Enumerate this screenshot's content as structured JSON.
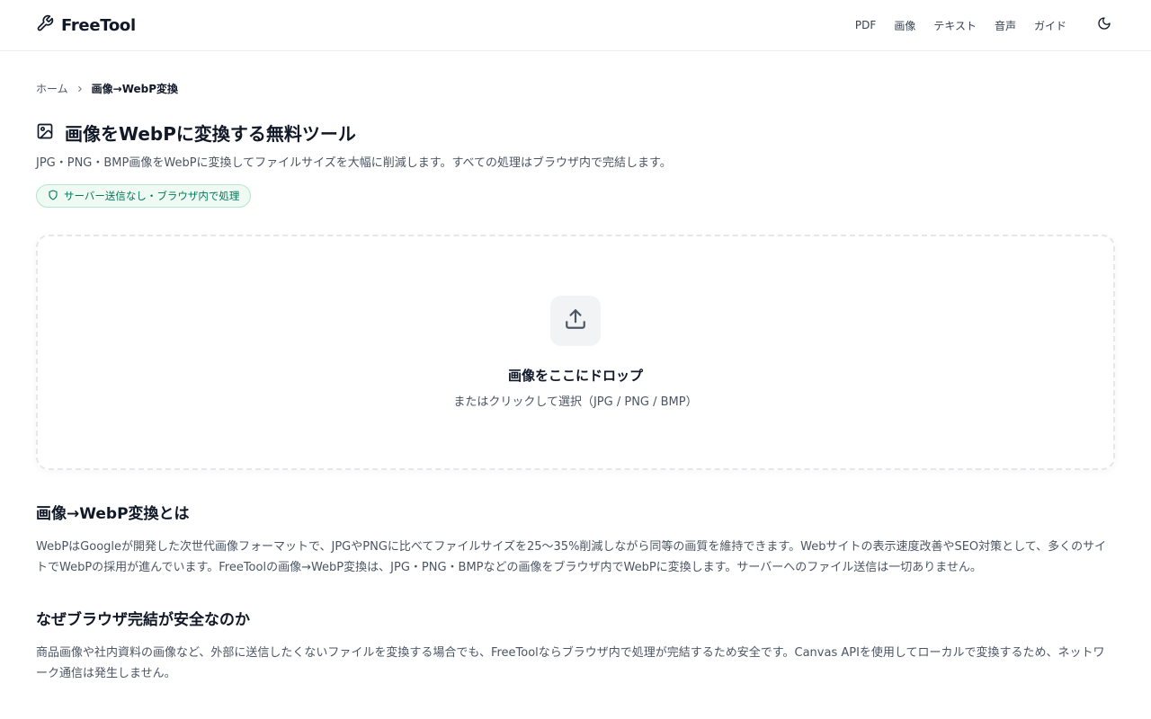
{
  "header": {
    "logo_text": "FreeTool",
    "nav": [
      "PDF",
      "画像",
      "テキスト",
      "音声",
      "ガイド"
    ],
    "theme_icon": "moon-icon"
  },
  "breadcrumb": {
    "home": "ホーム",
    "current": "画像→WebP変換"
  },
  "page": {
    "title": "画像をWebPに変換する無料ツール",
    "subtitle": "JPG・PNG・BMP画像をWebPに変換してファイルサイズを大幅に削減します。すべての処理はブラウザ内で完結します。",
    "badge": "サーバー送信なし・ブラウザ内で処理"
  },
  "dropzone": {
    "title": "画像をここにドロップ",
    "subtitle": "またはクリックして選択（JPG / PNG / BMP）"
  },
  "sections": [
    {
      "heading": "画像→WebP変換とは",
      "body": "WebPはGoogleが開発した次世代画像フォーマットで、JPGやPNGに比べてファイルサイズを25〜35%削減しながら同等の画質を維持できます。Webサイトの表示速度改善やSEO対策として、多くのサイトでWebPの採用が進んでいます。FreeToolの画像→WebP変換は、JPG・PNG・BMPなどの画像をブラウザ内でWebPに変換します。サーバーへのファイル送信は一切ありません。"
    },
    {
      "heading": "なぜブラウザ完結が安全なのか",
      "body": "商品画像や社内資料の画像など、外部に送信したくないファイルを変換する場合でも、FreeToolならブラウザ内で処理が完結するため安全です。Canvas APIを使用してローカルで変換するため、ネットワーク通信は発生しません。"
    }
  ],
  "colors": {
    "badge_text": "#047857",
    "badge_bg": "#eefaf3",
    "badge_border": "#b7e4cc",
    "text_primary": "#111827",
    "text_secondary": "#4b5563"
  }
}
